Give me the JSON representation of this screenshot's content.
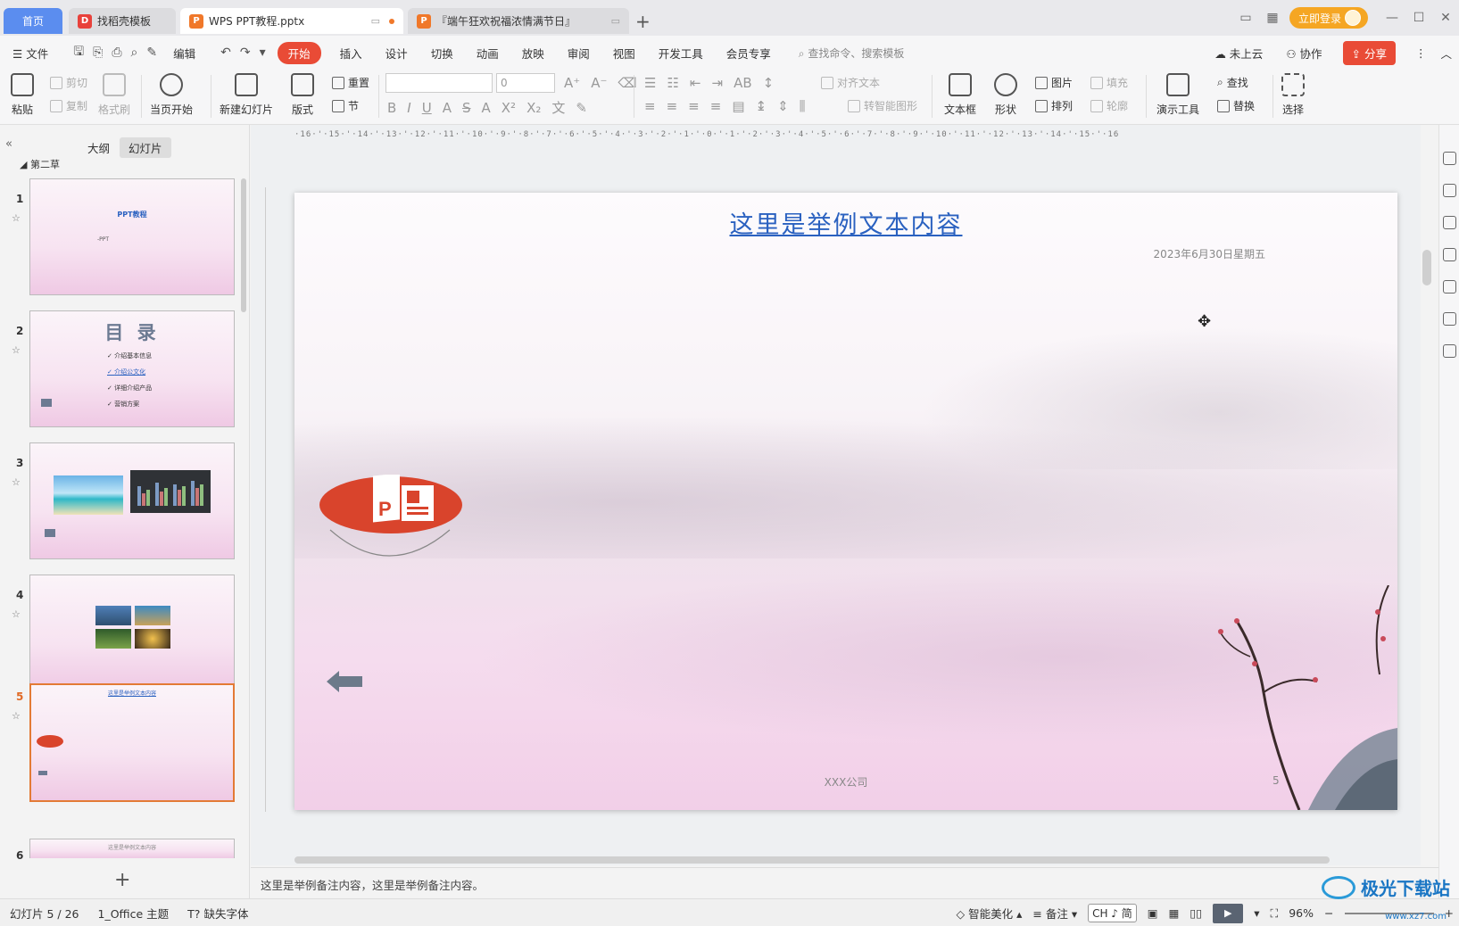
{
  "tabs": {
    "home": "首页",
    "tab1": "找稻壳模板",
    "tab2": "WPS PPT教程.pptx",
    "tab3": "『端午狂欢祝福浓情满节日』"
  },
  "titlebar": {
    "login": "立即登录"
  },
  "menubar": {
    "file": "文件",
    "edit": "编辑",
    "start": "开始",
    "insert": "插入",
    "design": "设计",
    "transition": "切换",
    "animation": "动画",
    "show": "放映",
    "review": "审阅",
    "view": "视图",
    "developer": "开发工具",
    "member": "会员专享",
    "search": "查找命令、搜索模板",
    "cloud": "未上云",
    "collab": "协作",
    "share": "分享"
  },
  "ribbon": {
    "paste": "粘贴",
    "cut": "剪切",
    "copy": "复制",
    "format_painter": "格式刷",
    "from_current": "当页开始",
    "new_slide": "新建幻灯片",
    "layout": "版式",
    "reset": "重置",
    "section": "节",
    "font_size": "0",
    "align_text": "对齐文本",
    "smart_shape": "转智能图形",
    "textbox": "文本框",
    "shapes": "形状",
    "picture": "图片",
    "arrange": "排列",
    "fill": "填充",
    "outline": "轮廓",
    "presenter_tools": "演示工具",
    "find": "查找",
    "replace": "替换",
    "select": "选择"
  },
  "left_panel": {
    "tab_outline": "大纲",
    "tab_slides": "幻灯片",
    "section": "第二草",
    "thumbs": [
      {
        "num": "1",
        "title": "PPT教程",
        "sub": "-PPT"
      },
      {
        "num": "2",
        "title": "目 录",
        "items": [
          "介绍基本信息",
          "介绍公文化",
          "详细介绍产品",
          "营销方案"
        ]
      },
      {
        "num": "3"
      },
      {
        "num": "4"
      },
      {
        "num": "5",
        "title": "这里是举例文本内容"
      },
      {
        "num": "6",
        "title": "这里是举例文本内容"
      }
    ]
  },
  "ruler_text": "·16·'·15·'·14·'·13·'·12·'·11·'·10·'·9·'·8·'·7·'·6·'·5·'·4·'·3·'·2·'·1·'·0·'·1·'·2·'·3·'·4·'·5·'·6·'·7·'·8·'·9·'·10·'·11·'·12·'·13·'·14·'·15·'·16",
  "slide": {
    "title": "这里是举例文本内容",
    "date": "2023年6月30日星期五",
    "footer": "XXX公司",
    "page": "5"
  },
  "notes": "这里是举例备注内容，这里是举例备注内容。",
  "statusbar": {
    "slide_count": "幻灯片 5 / 26",
    "theme": "1_Office 主题",
    "missing_font": "缺失字体",
    "beautify": "智能美化",
    "notes": "备注",
    "ime": "CH ♪ 简",
    "zoom": "96%"
  },
  "watermark": {
    "text": "极光下载站",
    "url": "www.xz7.com"
  },
  "colors": {
    "accent": "#e94b36",
    "link": "#2a61c0",
    "selected_border": "#e37a35"
  }
}
